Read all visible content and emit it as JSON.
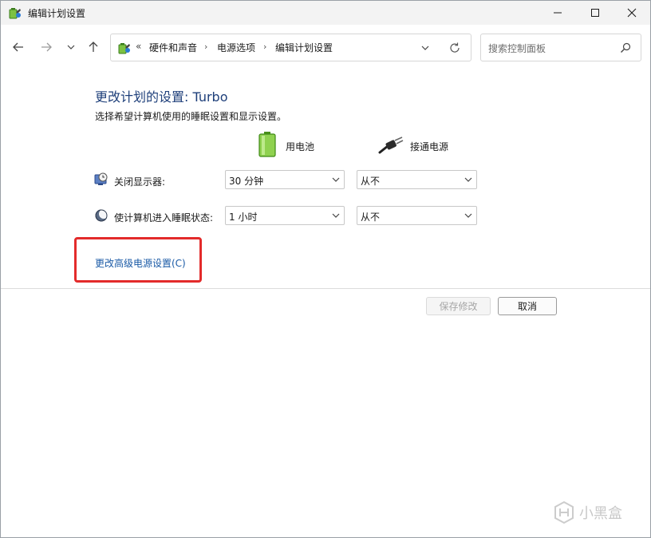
{
  "window": {
    "title": "编辑计划设置",
    "minimize_icon": "minimize-icon",
    "maximize_icon": "maximize-icon",
    "close_icon": "close-icon"
  },
  "nav": {
    "breadcrumb_prefix": "«",
    "breadcrumbs": [
      "硬件和声音",
      "电源选项",
      "编辑计划设置"
    ],
    "separator": "›",
    "search_placeholder": "搜索控制面板"
  },
  "main": {
    "heading": "更改计划的设置: Turbo",
    "subheading": "选择希望计算机使用的睡眠设置和显示设置。",
    "columns": {
      "battery": "用电池",
      "plugged_in": "接通电源"
    },
    "rows": [
      {
        "label": "关闭显示器:",
        "battery_value": "30 分钟",
        "plugged_value": "从不"
      },
      {
        "label": "使计算机进入睡眠状态:",
        "battery_value": "1 小时",
        "plugged_value": "从不"
      }
    ],
    "advanced_link": "更改高级电源设置(C)"
  },
  "buttons": {
    "save": "保存修改",
    "cancel": "取消"
  },
  "watermark": {
    "text": "小黑盒"
  },
  "colors": {
    "heading": "#1e3f7a",
    "link": "#1a5aa6",
    "highlight": "#e32b2b"
  }
}
